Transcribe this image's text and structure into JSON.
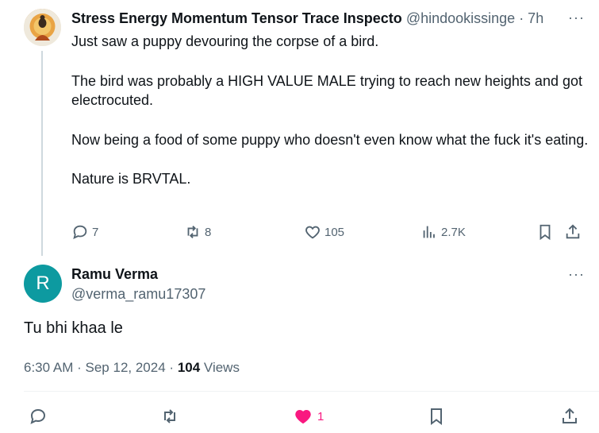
{
  "parent": {
    "author_name": "Stress Energy Momentum Tensor Trace Inspecto",
    "handle": "@hindookissinge",
    "time": "· 7h",
    "paragraphs": [
      "Just saw a puppy devouring the corpse of a bird.",
      "The bird was probably a HIGH VALUE MALE trying to reach new heights and got electrocuted.",
      "Now being a food of some puppy who doesn't even know what the fuck it's eating.",
      "Nature is BRVTAL."
    ],
    "stats": {
      "replies": "7",
      "reposts": "8",
      "likes": "105",
      "views": "2.7K"
    }
  },
  "reply": {
    "avatar_letter": "R",
    "author_name": "Ramu Verma",
    "handle": "@verma_ramu17307",
    "text": "Tu bhi khaa le",
    "time": "6:30 AM",
    "date": "Sep 12, 2024",
    "views_count": "104",
    "views_label": "Views",
    "likes": "1"
  },
  "more_label": "···",
  "colors": {
    "like_active": "#f91880",
    "avatar_bg": "#0d9aa0",
    "secondary_text": "#536471"
  }
}
